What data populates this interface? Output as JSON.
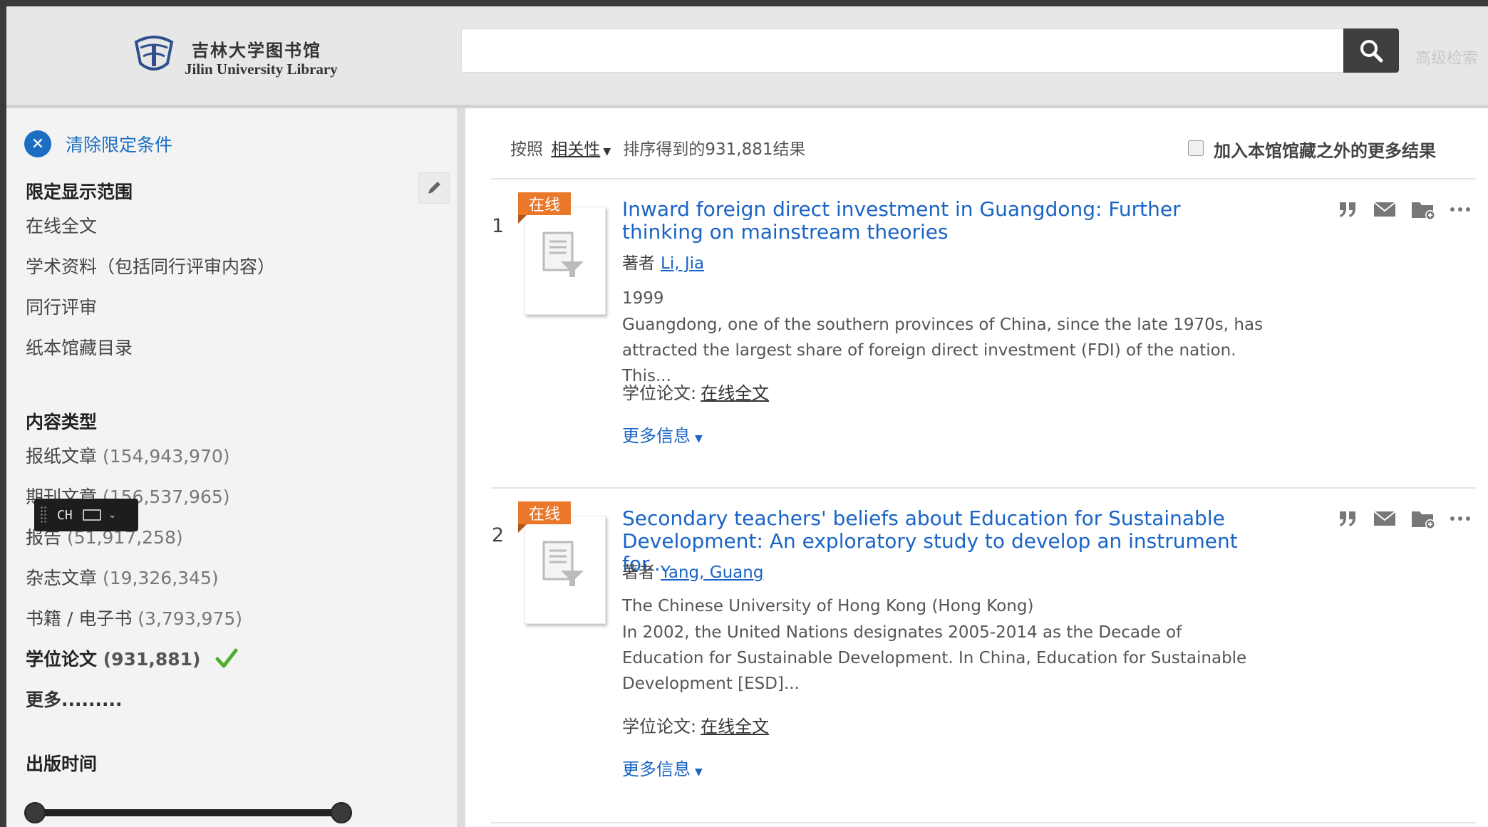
{
  "header": {
    "logo_cn": "吉林大学图书馆",
    "logo_en": "Jilin University Library",
    "search_value": "",
    "advanced_search": "高级检索"
  },
  "ime": {
    "label": "CH"
  },
  "sidebar": {
    "clear_filters": "清除限定条件",
    "show_only_heading": "限定显示范围",
    "show_only_items": [
      "在线全文",
      "学术资料（包括同行评审内容）",
      "同行评审",
      "纸本馆藏目录"
    ],
    "content_type_heading": "内容类型",
    "content_types": [
      {
        "label": "报纸文章",
        "count": "(154,943,970)"
      },
      {
        "label": "期刊文章",
        "count": "(156,537,965)"
      },
      {
        "label": "报告",
        "count": "(51,917,258)"
      },
      {
        "label": "杂志文章",
        "count": "(19,326,345)"
      },
      {
        "label": "书籍 / 电子书",
        "count": "(3,793,975)"
      },
      {
        "label": "学位论文",
        "count": "(931,881)",
        "active": true
      }
    ],
    "more": "更多.........",
    "pubdate_heading": "出版时间"
  },
  "sort_bar": {
    "prefix": "按照",
    "sort_value": "相关性",
    "suffix": "排序得到的931,881结果",
    "expand_label": "加入本馆馆藏之外的更多结果"
  },
  "results": [
    {
      "number": "1",
      "badge": "在线",
      "title": "Inward foreign direct investment in Guangdong: Further thinking on mainstream theories",
      "author_label": "著者",
      "author": "Li, Jia",
      "meta": "1999",
      "abstract": "Guangdong, one of the southern provinces of China, since the late 1970s, has attracted the largest share of foreign direct investment (FDI) of the nation. This...",
      "avail_label": "学位论文:",
      "avail_link": "在线全文",
      "more_info": "更多信息"
    },
    {
      "number": "2",
      "badge": "在线",
      "title": "Secondary teachers' beliefs about Education for Sustainable Development: An exploratory study to develop an instrument for...",
      "author_label": "著者",
      "author": "Yang, Guang",
      "meta": "The Chinese University of Hong Kong (Hong Kong)",
      "abstract": "In 2002, the United Nations designates 2005-2014 as the Decade of Education for Sustainable Development. In China, Education for Sustainable Development [ESD]...",
      "avail_label": "学位论文:",
      "avail_link": "在线全文",
      "more_info": "更多信息"
    }
  ],
  "colors": {
    "link": "#1a64c5",
    "badge": "#e9782a",
    "active_check": "#4caf2a",
    "search_button": "#3e3e3e"
  },
  "icons": {
    "search": "search-icon",
    "clear": "close-icon",
    "edit": "pencil-icon",
    "check": "checkmark-icon",
    "cite": "quote-icon",
    "email": "email-icon",
    "save": "folder-add-icon",
    "more": "ellipsis-icon"
  }
}
